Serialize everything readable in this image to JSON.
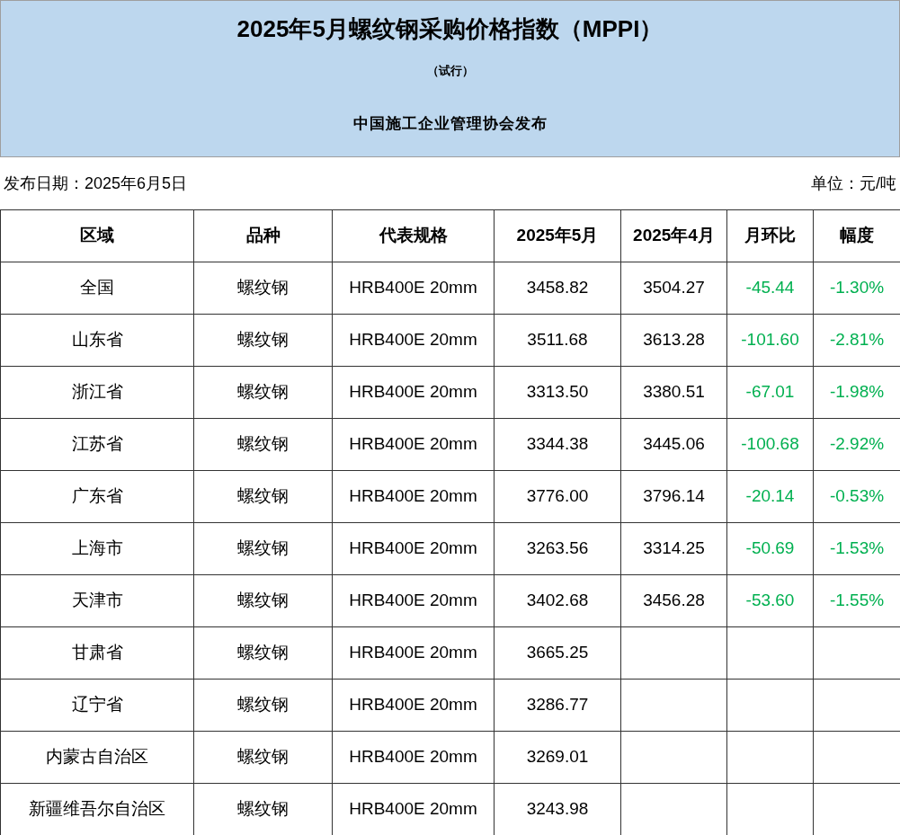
{
  "header": {
    "title": "2025年5月螺纹钢采购价格指数（MPPI）",
    "subtitle": "（试行）",
    "publisher": "中国施工企业管理协会发布"
  },
  "info": {
    "date": "发布日期：2025年6月5日",
    "unit": "单位：元/吨"
  },
  "table": {
    "columns": [
      "区域",
      "品种",
      "代表规格",
      "2025年5月",
      "2025年4月",
      "月环比",
      "幅度"
    ],
    "rows": [
      {
        "region": "全国",
        "variety": "螺纹钢",
        "spec": "HRB400E 20mm",
        "may": "3458.82",
        "april": "3504.27",
        "change": "-45.44",
        "pct": "-1.30%"
      },
      {
        "region": "山东省",
        "variety": "螺纹钢",
        "spec": "HRB400E 20mm",
        "may": "3511.68",
        "april": "3613.28",
        "change": "-101.60",
        "pct": "-2.81%"
      },
      {
        "region": "浙江省",
        "variety": "螺纹钢",
        "spec": "HRB400E 20mm",
        "may": "3313.50",
        "april": "3380.51",
        "change": "-67.01",
        "pct": "-1.98%"
      },
      {
        "region": "江苏省",
        "variety": "螺纹钢",
        "spec": "HRB400E 20mm",
        "may": "3344.38",
        "april": "3445.06",
        "change": "-100.68",
        "pct": "-2.92%"
      },
      {
        "region": "广东省",
        "variety": "螺纹钢",
        "spec": "HRB400E 20mm",
        "may": "3776.00",
        "april": "3796.14",
        "change": "-20.14",
        "pct": "-0.53%"
      },
      {
        "region": "上海市",
        "variety": "螺纹钢",
        "spec": "HRB400E 20mm",
        "may": "3263.56",
        "april": "3314.25",
        "change": "-50.69",
        "pct": "-1.53%"
      },
      {
        "region": "天津市",
        "variety": "螺纹钢",
        "spec": "HRB400E 20mm",
        "may": "3402.68",
        "april": "3456.28",
        "change": "-53.60",
        "pct": "-1.55%"
      },
      {
        "region": "甘肃省",
        "variety": "螺纹钢",
        "spec": "HRB400E 20mm",
        "may": "3665.25"
      },
      {
        "region": "辽宁省",
        "variety": "螺纹钢",
        "spec": "HRB400E 20mm",
        "may": "3286.77"
      },
      {
        "region": "内蒙古自治区",
        "variety": "螺纹钢",
        "spec": "HRB400E 20mm",
        "may": "3269.01"
      },
      {
        "region": "新疆维吾尔自治区",
        "variety": "螺纹钢",
        "spec": "HRB400E 20mm",
        "may": "3243.98"
      }
    ]
  }
}
